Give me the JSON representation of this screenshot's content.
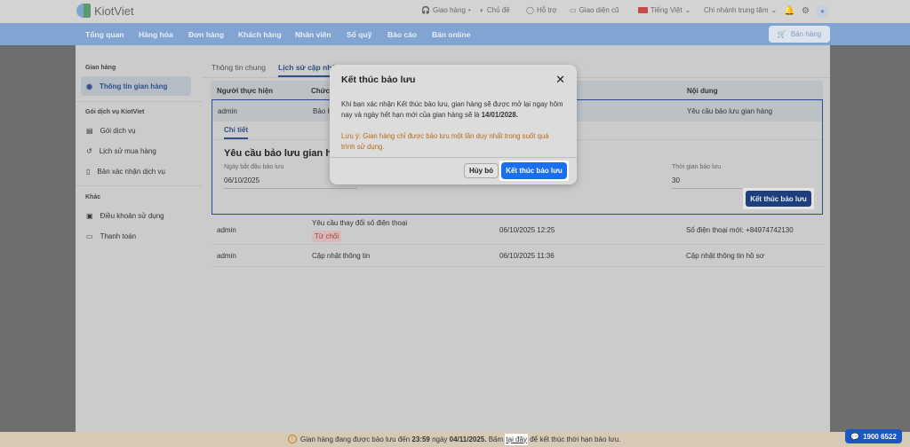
{
  "header": {
    "logo": "KiotViet",
    "delivery": "Giao hàng",
    "theme": "Chủ đề",
    "support": "Hỗ trợ",
    "old_ui": "Giao diện cũ",
    "language": "Tiếng Việt",
    "branch": "Chi nhánh trung tâm"
  },
  "nav": {
    "items": [
      "Tổng quan",
      "Hàng hóa",
      "Đơn hàng",
      "Khách hàng",
      "Nhân viên",
      "Sổ quỹ",
      "Báo cáo",
      "Bán online"
    ],
    "sell": "Bán hàng"
  },
  "sidebar": {
    "group1": "Gian hàng",
    "store_info": "Thông tin gian hàng",
    "group2": "Gói dịch vụ KiotViet",
    "service_pack": "Gói dịch vụ",
    "purchase_history": "Lịch sử mua hàng",
    "service_confirm": "Bản xác nhận dịch vụ",
    "group3": "Khác",
    "terms": "Điều khoản sử dụng",
    "payment": "Thanh toán"
  },
  "tabs": {
    "general": "Thông tin chung",
    "history": "Lịch sử cập nhật"
  },
  "table": {
    "headers": [
      "Người thực hiện",
      "Chức năng",
      "Nội dung"
    ],
    "row1": {
      "user": "admin",
      "func": "Bảo lưu",
      "content": "Yêu cầu bảo lưu gian hàng"
    },
    "detail": {
      "tab": "Chi tiết",
      "title": "Yêu cầu bảo lưu gian hàng",
      "start_label": "Ngày bắt đầu bảo lưu",
      "start_value": "06/10/2025",
      "duration_label": "Thời gian bảo lưu",
      "duration_value": "30",
      "end_button": "Kết thúc bảo lưu"
    },
    "rows": [
      {
        "user": "admin",
        "func": "Yêu cầu thay đổi số điện thoại",
        "badge": "Từ chối",
        "time": "06/10/2025 12:25",
        "content": "Số điện thoại mới: +84974742130"
      },
      {
        "user": "admin",
        "func": "Cập nhật thông tin",
        "time": "06/10/2025 11:36",
        "content": "Cập nhật thông tin hồ sơ"
      }
    ]
  },
  "modal": {
    "title": "Kết thúc bảo lưu",
    "body": "Khi bạn xác nhận Kết thúc bảo lưu, gian hàng sẽ được mở lại ngay hôm nay và ngày hết hạn mới của gian hàng sẽ là ",
    "date": "14/01/2028.",
    "note": "Lưu ý: Gian hàng chỉ được bảo lưu một lần duy nhất trong suốt quá trình sử dụng.",
    "cancel": "Hủy bỏ",
    "confirm": "Kết thúc bảo lưu"
  },
  "footer": {
    "t1": "Gian hàng đang được bảo lưu đến ",
    "time": "23:59",
    "t2": " ngày ",
    "date": "04/11/2025.",
    "t3": " Bấm ",
    "link": "tại đây",
    "t4": " để kết thúc thời hạn bảo lưu.",
    "hotline": "1900 6522"
  }
}
